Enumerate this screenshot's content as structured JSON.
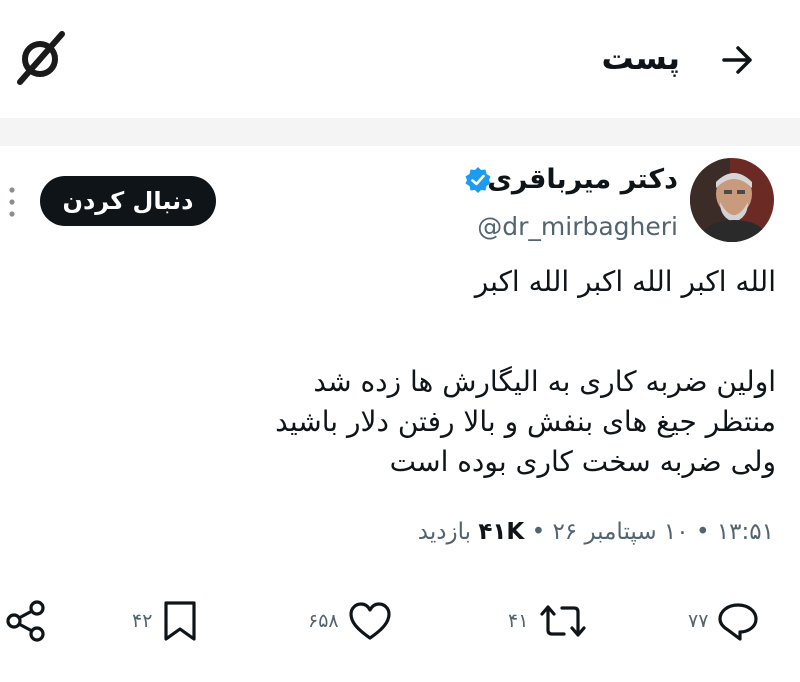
{
  "header": {
    "title": "پست",
    "back_icon": "arrow-right-icon",
    "logo_icon": "app-logo-icon"
  },
  "author": {
    "name": "دکتر میرباقری",
    "handle": "@dr_mirbagheri",
    "verified_icon": "verified-badge-icon",
    "follow_label": "دنبال کردن"
  },
  "tweet": {
    "line1": "الله اکبر الله اکبر الله اکبر",
    "line2": "اولین ضربه کاری به الیگارش ها زده شد",
    "line3": "منتظر جیغ های بنفش و بالا رفتن دلار باشید",
    "line4": "ولی ضربه سخت کاری بوده است"
  },
  "meta": {
    "time": "۱۳:۵۱",
    "date": "۱۰ سپتامبر ۲۶",
    "views_count": "۴۱K",
    "views_label": "بازدید",
    "separator": "•"
  },
  "actions": {
    "replies": "۷۷",
    "retweets": "۴۱",
    "likes": "۶۵۸",
    "bookmarks": "۴۲"
  },
  "colors": {
    "text": "#0f1419",
    "secondary": "#536471",
    "verified": "#1d9bf0",
    "button_bg": "#0f1419",
    "divider": "#f4f4f4"
  }
}
